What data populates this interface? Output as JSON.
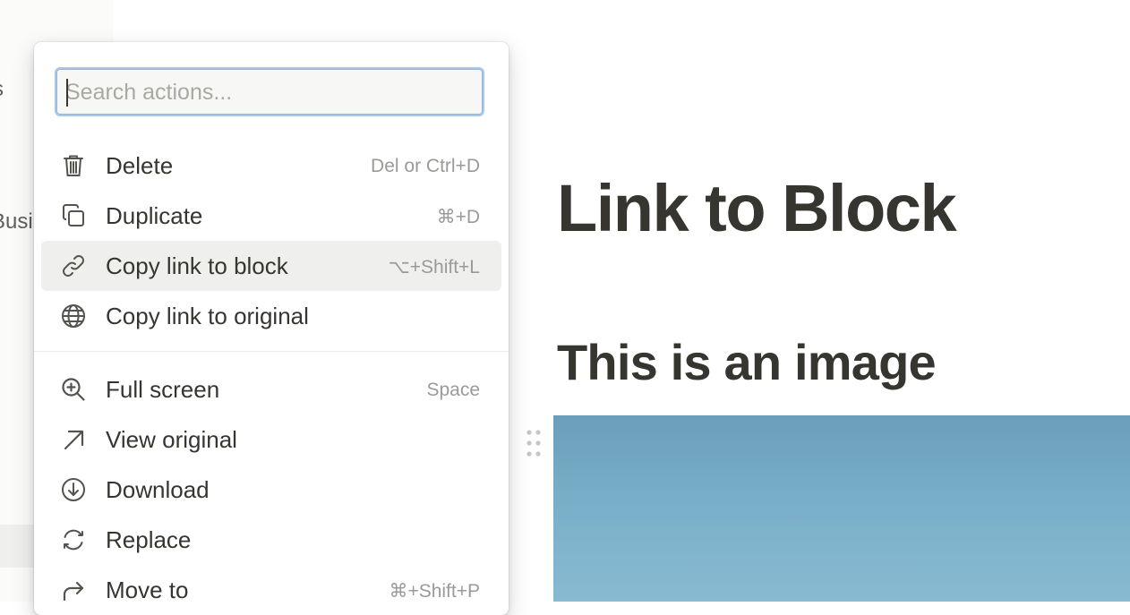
{
  "sidebar": {
    "fragment_top": "s",
    "fragment_mid": "Busi"
  },
  "page": {
    "title": "Link to Block",
    "heading": "This is an image"
  },
  "menu": {
    "search": {
      "placeholder": "Search actions...",
      "value": ""
    },
    "items": [
      {
        "label": "Delete",
        "shortcut": "Del or Ctrl+D",
        "icon": "trash-icon"
      },
      {
        "label": "Duplicate",
        "shortcut": "⌘+D",
        "icon": "duplicate-icon"
      },
      {
        "label": "Copy link to block",
        "shortcut": "⌥+Shift+L",
        "icon": "link-icon",
        "active": true
      },
      {
        "label": "Copy link to original",
        "shortcut": "",
        "icon": "globe-icon"
      },
      {
        "label": "Full screen",
        "shortcut": "Space",
        "icon": "zoom-in-icon"
      },
      {
        "label": "View original",
        "shortcut": "",
        "icon": "arrow-up-right-icon"
      },
      {
        "label": "Download",
        "shortcut": "",
        "icon": "download-icon"
      },
      {
        "label": "Replace",
        "shortcut": "",
        "icon": "replace-icon"
      },
      {
        "label": "Move to",
        "shortcut": "⌘+Shift+P",
        "icon": "move-to-icon"
      }
    ]
  },
  "colors": {
    "text": "#37352f",
    "muted": "#9b9a97",
    "active_bg": "#efefed",
    "focus_ring": "#a8c8ee"
  }
}
